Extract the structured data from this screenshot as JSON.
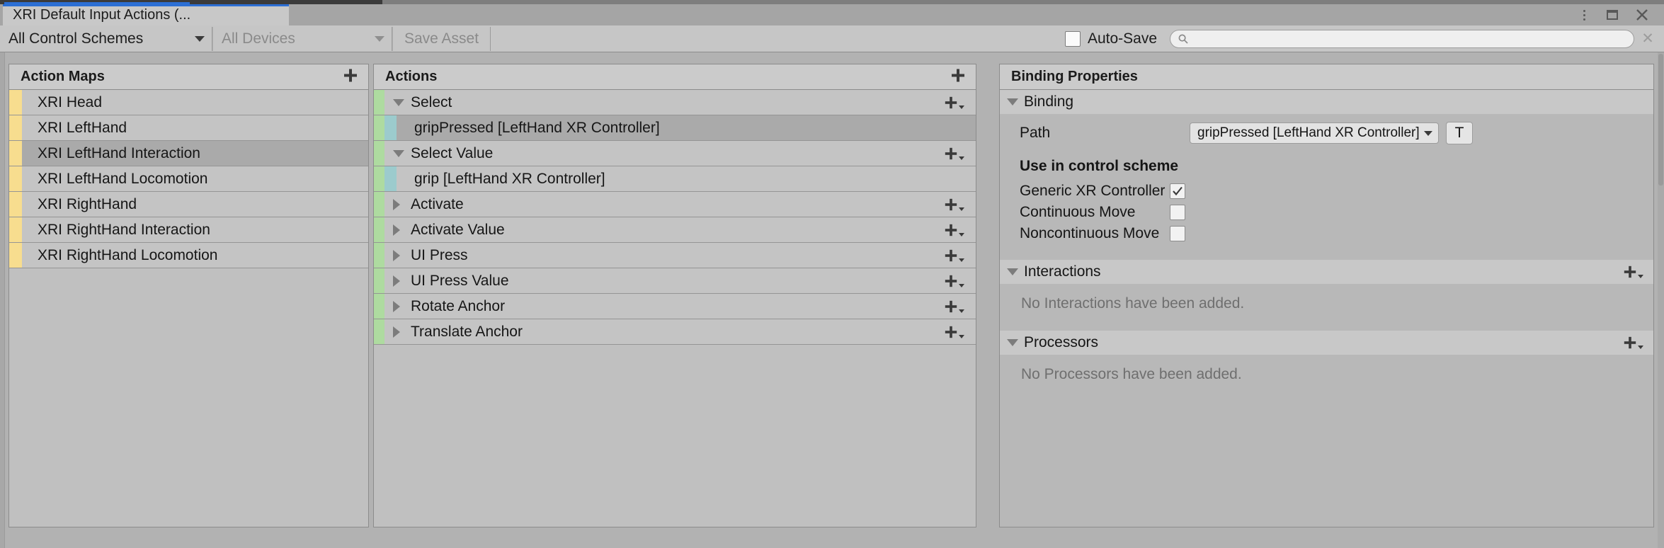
{
  "window": {
    "tab_title": "XRI Default Input Actions (...",
    "kebab_icon": "kebab-menu-icon",
    "maximize_icon": "maximize-icon",
    "close_label": "✕"
  },
  "toolbar": {
    "control_schemes": "All Control Schemes",
    "devices": "All Devices",
    "save_asset": "Save Asset",
    "autosave_label": "Auto-Save",
    "autosave_checked": false,
    "search_value": "",
    "search_placeholder": "",
    "search_icon": "search-icon",
    "clear_label": "✕"
  },
  "action_maps": {
    "header": "Action Maps",
    "add_label": "+",
    "accent_color": "#f7dd8f",
    "items": [
      {
        "label": "XRI Head",
        "selected": false
      },
      {
        "label": "XRI LeftHand",
        "selected": false
      },
      {
        "label": "XRI LeftHand Interaction",
        "selected": true
      },
      {
        "label": "XRI LeftHand Locomotion",
        "selected": false
      },
      {
        "label": "XRI RightHand",
        "selected": false
      },
      {
        "label": "XRI RightHand Interaction",
        "selected": false
      },
      {
        "label": "XRI RightHand Locomotion",
        "selected": false
      }
    ]
  },
  "actions": {
    "header": "Actions",
    "add_label": "+",
    "action_color": "#aedba0",
    "binding_color": "#9ccbcd",
    "items": [
      {
        "label": "Select",
        "type": "action",
        "expanded": true,
        "selected": false
      },
      {
        "label": "gripPressed [LeftHand XR Controller]",
        "type": "binding",
        "selected": true
      },
      {
        "label": "Select Value",
        "type": "action",
        "expanded": true,
        "selected": false
      },
      {
        "label": "grip [LeftHand XR Controller]",
        "type": "binding",
        "selected": false
      },
      {
        "label": "Activate",
        "type": "action",
        "expanded": false,
        "selected": false
      },
      {
        "label": "Activate Value",
        "type": "action",
        "expanded": false,
        "selected": false
      },
      {
        "label": "UI Press",
        "type": "action",
        "expanded": false,
        "selected": false
      },
      {
        "label": "UI Press Value",
        "type": "action",
        "expanded": false,
        "selected": false
      },
      {
        "label": "Rotate Anchor",
        "type": "action",
        "expanded": false,
        "selected": false
      },
      {
        "label": "Translate Anchor",
        "type": "action",
        "expanded": false,
        "selected": false
      }
    ]
  },
  "binding_properties": {
    "header": "Binding Properties",
    "binding_section": "Binding",
    "path_label": "Path",
    "path_value": "gripPressed [LeftHand XR Controller]",
    "path_t_button": "T",
    "use_in_scheme_title": "Use in control scheme",
    "schemes": [
      {
        "label": "Generic XR Controller",
        "checked": true
      },
      {
        "label": "Continuous Move",
        "checked": false
      },
      {
        "label": "Noncontinuous Move",
        "checked": false
      }
    ],
    "interactions_section": "Interactions",
    "interactions_empty": "No Interactions have been added.",
    "processors_section": "Processors",
    "processors_empty": "No Processors have been added.",
    "add_label": "+"
  }
}
